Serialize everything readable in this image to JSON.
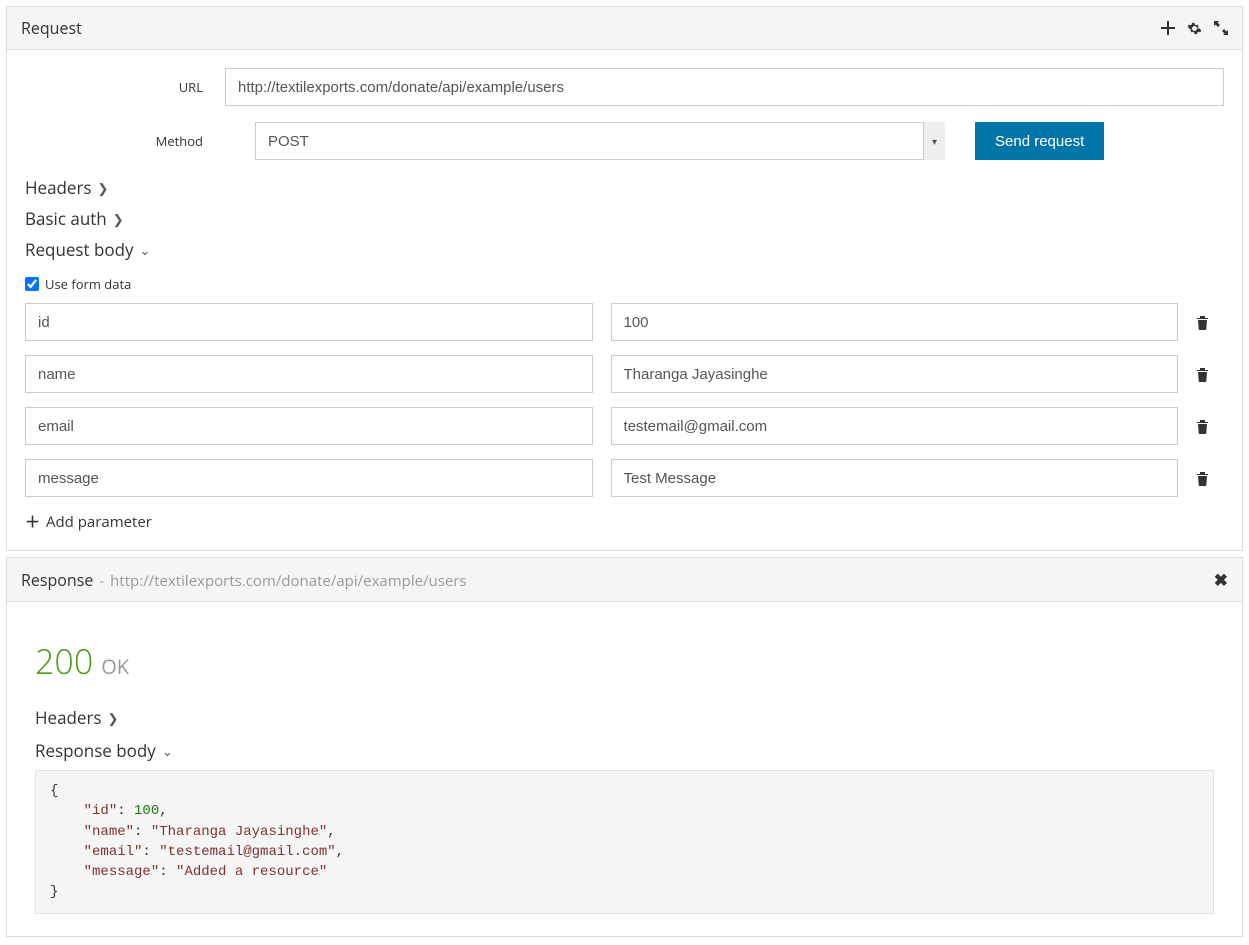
{
  "request": {
    "panel_title": "Request",
    "url_label": "URL",
    "url_value": "http://textilexports.com/donate/api/example/users",
    "method_label": "Method",
    "method_value": "POST",
    "send_button": "Send request",
    "sections": {
      "headers": "Headers",
      "basic_auth": "Basic auth",
      "request_body": "Request body"
    },
    "use_form_data_label": "Use form data",
    "use_form_data_checked": true,
    "params": [
      {
        "key": "id",
        "value": "100"
      },
      {
        "key": "name",
        "value": "Tharanga Jayasinghe"
      },
      {
        "key": "email",
        "value": "testemail@gmail.com"
      },
      {
        "key": "message",
        "value": "Test Message"
      }
    ],
    "add_param_label": "Add parameter"
  },
  "response": {
    "panel_title": "Response",
    "url": "http://textilexports.com/donate/api/example/users",
    "status_code": "200",
    "status_text": "OK",
    "sections": {
      "headers": "Headers",
      "body": "Response body"
    },
    "body_json": {
      "id": 100,
      "name": "Tharanga Jayasinghe",
      "email": "testemail@gmail.com",
      "message": "Added a resource"
    }
  }
}
